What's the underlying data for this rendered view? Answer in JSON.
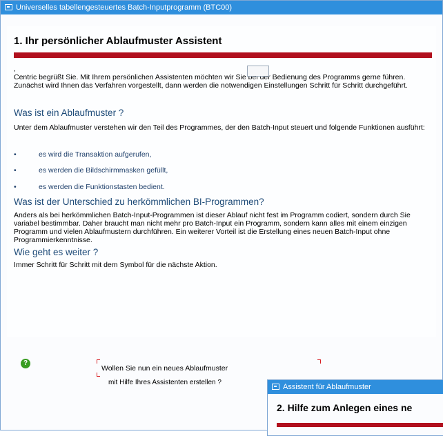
{
  "window": {
    "title": "Universelles tabellengesteuertes Batch-Inputprogramm (BTC00)"
  },
  "document": {
    "heading": "1. Ihr persönlicher Ablaufmuster Assistent",
    "comma": ",",
    "intro": "Centric begrüßt Sie. Mit Ihrem persönlichen Assistenten möchten wir Sie bei der Bedienung des Programms gerne führen. Zunächst wird Ihnen das Verfahren vorgestellt, dann werden die notwendigen Einstellungen Schritt für Schritt durchgeführt.",
    "section1_title": "Was ist ein Ablaufmuster ?",
    "section1_text": "Unter dem Ablaufmuster verstehen wir den Teil des Programmes, der den Batch-Input steuert und folgende Funktionen ausführt:",
    "bullet_symbol": "•",
    "bullets": [
      "es wird die Transaktion aufgerufen,",
      "es werden die Bildschirmmasken gefüllt,",
      "es werden die Funktionstasten bedient."
    ],
    "section2_title": "Was ist der Unterschied zu herkömmlichen BI-Programmen?",
    "section2_text": "Anders als bei herkömmlichen Batch-Input-Programmen ist dieser Ablauf nicht fest im Programm codiert, sondern durch Sie variabel bestimmbar. Daher braucht man nicht mehr pro Batch-Input ein Programm, sondern kann alles mit einem einzigen Programm und vielen Ablaufmustern durchführen. Ein weiterer Vorteil ist die Erstellung eines neuen Batch-Input ohne Programmierkenntnisse.",
    "section3_title": "Wie geht es weiter ?",
    "section3_text": "Immer Schritt für Schritt mit dem Symbol für die nächste Aktion."
  },
  "prompt": {
    "icon": "question-icon",
    "question_mark": "?",
    "line1": "Wollen Sie nun ein neues Ablaufmuster",
    "line2": "mit Hilfe Ihres Assistenten erstellen ?"
  },
  "second_window": {
    "title": "Assistent für Ablaufmuster",
    "heading": "2. Hilfe zum Anlegen eines ne"
  },
  "colors": {
    "titlebar": "#2f8fdd",
    "accent_bar": "#b1101e",
    "subheading": "#1e4b78",
    "bullet_text": "#1e3f6a",
    "question_icon": "#3a9d23"
  }
}
